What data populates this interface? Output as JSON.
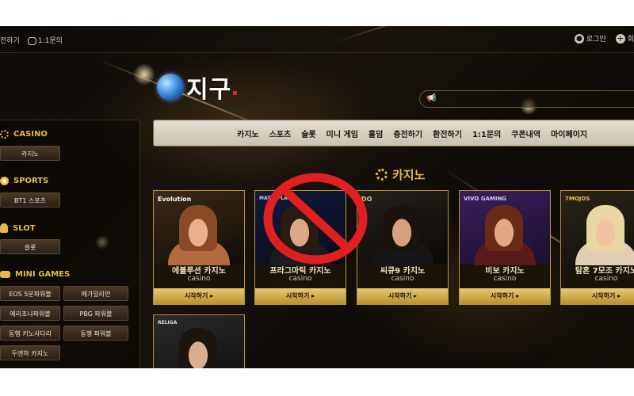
{
  "topbar": {
    "left_link_partial": "전하기",
    "inquiry_link": "1:1문의",
    "login": "로그인",
    "signup_partial": "회"
  },
  "logo": {
    "text": "지구"
  },
  "main_nav": [
    "카지노",
    "스포츠",
    "슬롯",
    "미니 게임",
    "홀덤",
    "충전하기",
    "환전하기",
    "1:1문의",
    "쿠폰내역",
    "마이페이지"
  ],
  "sidebar": {
    "casino": {
      "title": "CASINO",
      "items": [
        "카지노"
      ]
    },
    "sports": {
      "title": "SPORTS",
      "items": [
        "BT1 스포츠"
      ]
    },
    "slot": {
      "title": "SLOT",
      "items": [
        "슬롯"
      ]
    },
    "mini_games": {
      "title": "MINI GAMES",
      "items": [
        "EOS 5분파워볼",
        "메가밀리언",
        "에리조나파워볼",
        "PBG 파워볼",
        "동행 키노사다리",
        "동행 파워볼",
        "두엔하 카지노"
      ]
    }
  },
  "section_title": "카지노",
  "cards": [
    {
      "brand": "Evolution",
      "title": "에볼루션 카지노",
      "sub": "casino",
      "button": "시작하기 ▸"
    },
    {
      "brand": "MATIC PLAY",
      "title": "프라그마틱 카지노",
      "sub": "casino",
      "button": "시작하기 ▸"
    },
    {
      "brand": "DO",
      "title": "씨큐9 카지노",
      "sub": "casino",
      "button": "시작하기 ▸"
    },
    {
      "brand": "VIVO GAMING",
      "title": "비보 카지노",
      "sub": "casino",
      "button": "시작하기 ▸"
    },
    {
      "brand": "7MOJOS",
      "title": "탐혼 7모조 카지노",
      "sub": "casino",
      "button": "시작하기 ▸"
    },
    {
      "brand": "RELIGA",
      "title": "",
      "sub": "",
      "button": ""
    }
  ],
  "colors": {
    "gold": "#e7b84c",
    "prohibition_red": "#e02020",
    "nav_bg": "#d8d1c4"
  }
}
